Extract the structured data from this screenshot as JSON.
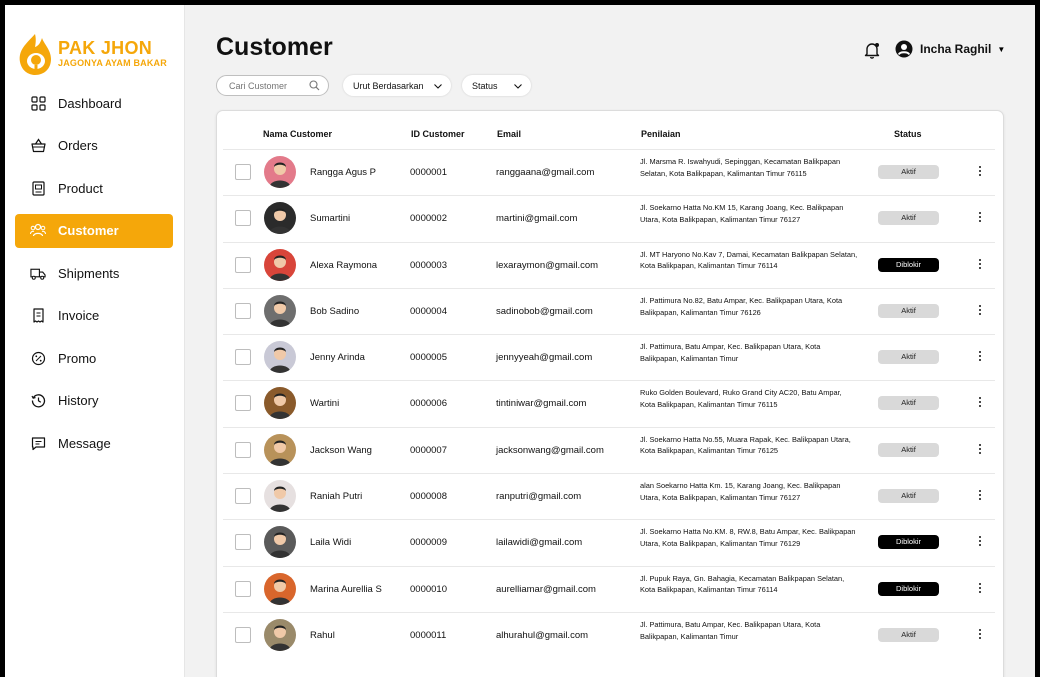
{
  "brand": {
    "title": "PAK JHON",
    "subtitle": "JAGONYA AYAM BAKAR",
    "color": "#f5a70a"
  },
  "sidebar": {
    "items": [
      {
        "label": "Dashboard",
        "icon": "grid-icon",
        "active": false
      },
      {
        "label": "Orders",
        "icon": "basket-icon",
        "active": false
      },
      {
        "label": "Product",
        "icon": "product-box-icon",
        "active": false
      },
      {
        "label": "Customer",
        "icon": "users-icon",
        "active": true
      },
      {
        "label": "Shipments",
        "icon": "truck-icon",
        "active": false
      },
      {
        "label": "Invoice",
        "icon": "receipt-icon",
        "active": false
      },
      {
        "label": "Promo",
        "icon": "percent-badge-icon",
        "active": false
      },
      {
        "label": "History",
        "icon": "clock-history-icon",
        "active": false
      },
      {
        "label": "Message",
        "icon": "chat-icon",
        "active": false
      }
    ]
  },
  "header": {
    "title": "Customer",
    "user_name": "Incha Raghil"
  },
  "filters": {
    "search_placeholder": "Cari Customer",
    "sort_label": "Urut Berdasarkan",
    "status_label": "Status"
  },
  "table": {
    "columns": {
      "name": "Nama Customer",
      "id": "ID Customer",
      "email": "Email",
      "rating": "Penilaian",
      "status": "Status"
    },
    "rows": [
      {
        "name": "Rangga Agus P",
        "id": "0000001",
        "email": "ranggaana@gmail.com",
        "address": "Jl. Marsma R. Iswahyudi, Sepinggan, Kecamatan Balikpapan Selatan, Kota Balikpapan, Kalimantan Timur 76115",
        "status": "Aktif",
        "avatar_color": "#e37a8a"
      },
      {
        "name": "Sumartini",
        "id": "0000002",
        "email": "martini@gmail.com",
        "address": "Jl. Soekarno Hatta No.KM 15, Karang Joang, Kec. Balikpapan Utara, Kota Balikpapan, Kalimantan Timur 76127",
        "status": "Aktif",
        "avatar_color": "#2b2b2b"
      },
      {
        "name": "Alexa Raymona",
        "id": "0000003",
        "email": "lexaraymon@gmail.com",
        "address": "Jl. MT Haryono No.Kav 7, Damai, Kecamatan Balikpapan Selatan, Kota Balikpapan, Kalimantan Timur 76114",
        "status": "Diblokir",
        "avatar_color": "#d8453a"
      },
      {
        "name": "Bob Sadino",
        "id": "0000004",
        "email": "sadinobob@gmail.com",
        "address": "Jl. Pattimura No.82, Batu Ampar, Kec. Balikpapan Utara, Kota Balikpapan, Kalimantan Timur 76126",
        "status": "Aktif",
        "avatar_color": "#6e6e6e"
      },
      {
        "name": "Jenny Arinda",
        "id": "0000005",
        "email": "jennyyeah@gmail.com",
        "address": "Jl. Pattimura, Batu Ampar, Kec. Balikpapan Utara, Kota Balikpapan, Kalimantan Timur",
        "status": "Aktif",
        "avatar_color": "#c9c9d6"
      },
      {
        "name": "Wartini",
        "id": "0000006",
        "email": "tintiniwar@gmail.com",
        "address": "Ruko Golden Boulevard, Ruko Grand City AC20, Batu Ampar, Kota Balikpapan, Kalimantan Timur 76115",
        "status": "Aktif",
        "avatar_color": "#8a5a2b"
      },
      {
        "name": "Jackson Wang",
        "id": "0000007",
        "email": "jacksonwang@gmail.com",
        "address": "Jl. Soekarno Hatta No.55, Muara Rapak, Kec. Balikpapan Utara, Kota Balikpapan, Kalimantan Timur 76125",
        "status": "Aktif",
        "avatar_color": "#b8925a"
      },
      {
        "name": "Raniah Putri",
        "id": "0000008",
        "email": "ranputri@gmail.com",
        "address": "alan Soekarno Hatta Km. 15, Karang Joang, Kec. Balikpapan Utara, Kota Balikpapan, Kalimantan Timur 76127",
        "status": "Aktif",
        "avatar_color": "#e6e0e0"
      },
      {
        "name": "Laila Widi",
        "id": "0000009",
        "email": "lailawidi@gmail.com",
        "address": "Jl. Soekarno Hatta No.KM. 8, RW.8, Batu Ampar, Kec. Balikpapan Utara, Kota Balikpapan, Kalimantan Timur 76129",
        "status": "Diblokir",
        "avatar_color": "#5a5a5a"
      },
      {
        "name": "Marina Aurellia S",
        "id": "0000010",
        "email": "aurelliamar@gmail.com",
        "address": "Jl. Pupuk Raya, Gn. Bahagia, Kecamatan Balikpapan Selatan, Kota Balikpapan, Kalimantan Timur 76114",
        "status": "Diblokir",
        "avatar_color": "#d9662c"
      },
      {
        "name": "Rahul",
        "id": "0000011",
        "email": "alhurahul@gmail.com",
        "address": "Jl. Pattimura, Batu Ampar, Kec. Balikpapan Utara, Kota Balikpapan, Kalimantan Timur",
        "status": "Aktif",
        "avatar_color": "#9a8a6a"
      }
    ]
  },
  "colors": {
    "accent": "#f5a70a",
    "blocked_badge": "#000000",
    "active_badge": "#d9d9d9"
  }
}
